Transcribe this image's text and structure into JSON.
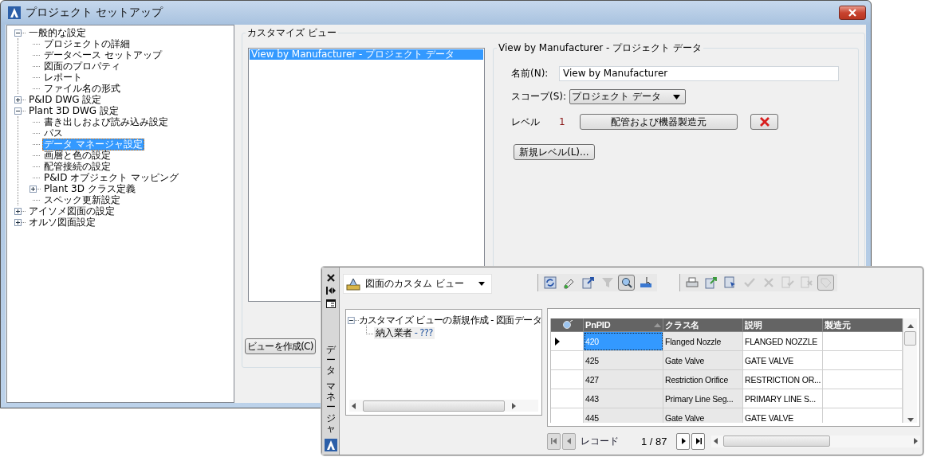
{
  "window": {
    "title": "プロジェクト セットアップ"
  },
  "tree": [
    {
      "label": "一般的な設定",
      "expanded": true,
      "selected": false,
      "children": [
        {
          "label": "プロジェクトの詳細",
          "selected": false
        },
        {
          "label": "データベース セットアップ",
          "selected": false
        },
        {
          "label": "図面のプロパティ",
          "selected": false
        },
        {
          "label": "レポート",
          "selected": false
        },
        {
          "label": "ファイル名の形式",
          "selected": false
        }
      ]
    },
    {
      "label": "P&ID DWG 設定",
      "expanded": false,
      "selected": false
    },
    {
      "label": "Plant 3D DWG 設定",
      "expanded": true,
      "selected": false,
      "children": [
        {
          "label": "書き出しおよび読み込み設定",
          "selected": false
        },
        {
          "label": "パス",
          "selected": false
        },
        {
          "label": "データ マネージャ設定",
          "selected": true
        },
        {
          "label": "画層と色の設定",
          "selected": false
        },
        {
          "label": "配管接続の設定",
          "selected": false
        },
        {
          "label": "P&ID オブジェクト マッピング",
          "selected": false
        },
        {
          "label": "Plant 3D クラス定義",
          "expanded": false,
          "selected": false
        },
        {
          "label": "スペック更新設定",
          "selected": false
        }
      ]
    },
    {
      "label": "アイソメ図面の設定",
      "expanded": false,
      "selected": false
    },
    {
      "label": "オルソ図面設定",
      "expanded": false,
      "selected": false
    }
  ],
  "custom_view": {
    "group_title": "カスタマイズ ビュー",
    "views": [
      {
        "label": "View by Manufacturer - プロジェクト データ",
        "selected": true
      }
    ],
    "create_button": "ビューを作成(C)"
  },
  "view_detail": {
    "group_title": "View by Manufacturer - プロジェクト データ",
    "name_label": "名前(N):",
    "name_value": "View by Manufacturer",
    "scope_label": "スコープ(S):",
    "scope_value": "プロジェクト データ",
    "level_label": "レベル",
    "level_number": "1",
    "level_button": "配管および機器製造元",
    "new_level_button": "新規レベル(L)..."
  },
  "data_manager": {
    "side_title": [
      "データ",
      "マネージャ"
    ],
    "view_select": "図面のカスタム ビュー",
    "toolbar": [
      {
        "items": [
          {
            "kind": "refresh",
            "disabled": false,
            "pressed": false
          },
          {
            "kind": "pencil",
            "disabled": false,
            "pressed": false
          },
          {
            "kind": "export",
            "disabled": false,
            "pressed": false
          },
          {
            "kind": "funnel",
            "disabled": true,
            "pressed": false
          },
          {
            "kind": "magnifier",
            "disabled": false,
            "pressed": true
          },
          {
            "kind": "ruler",
            "disabled": false,
            "pressed": false
          }
        ]
      },
      {
        "items": [
          {
            "kind": "printer",
            "disabled": false,
            "pressed": false
          },
          {
            "kind": "import",
            "disabled": false,
            "pressed": false
          },
          {
            "kind": "table",
            "disabled": false,
            "pressed": false
          },
          {
            "kind": "check",
            "disabled": true,
            "pressed": false
          },
          {
            "kind": "cross",
            "disabled": true,
            "pressed": false
          },
          {
            "kind": "page-check",
            "disabled": true,
            "pressed": false
          },
          {
            "kind": "page-cross",
            "disabled": true,
            "pressed": false
          },
          {
            "kind": "tag",
            "disabled": true,
            "pressed": true
          }
        ]
      }
    ],
    "view_tree": [
      {
        "label": "カスタマイズ ビューの新規作成 - 図面データ",
        "expanded": true,
        "children": [
          {
            "label": "納入業者",
            "detail": "- ???"
          }
        ]
      }
    ],
    "table": {
      "columns": [
        {
          "label": "PnPID",
          "sorted": true
        },
        {
          "label": "クラス名",
          "sorted": false
        },
        {
          "label": "説明",
          "sorted": false
        },
        {
          "label": "製造元",
          "sorted": false
        }
      ],
      "rows": [
        {
          "selected": true,
          "cells": [
            "420",
            "Flanged Nozzle",
            "FLANGED NOZZLE"
          ]
        },
        {
          "selected": false,
          "cells": [
            "425",
            "Gate Valve",
            "GATE VALVE"
          ]
        },
        {
          "selected": false,
          "cells": [
            "427",
            "Restriction Orifice",
            "RESTRICTION OR..."
          ]
        },
        {
          "selected": false,
          "cells": [
            "443",
            "Primary Line Seg...",
            "PRIMARY LINE S..."
          ]
        },
        {
          "selected": false,
          "cells": [
            "445",
            "Gate Valve",
            "GATE VALVE"
          ]
        }
      ]
    },
    "nav": [
      {
        "kind": "first",
        "disabled": true
      },
      {
        "kind": "previous",
        "disabled": true
      },
      {
        "kind": "next",
        "disabled": false
      },
      {
        "kind": "last",
        "disabled": false
      }
    ],
    "record_label": "レコード",
    "record_position": "1 / 87"
  }
}
